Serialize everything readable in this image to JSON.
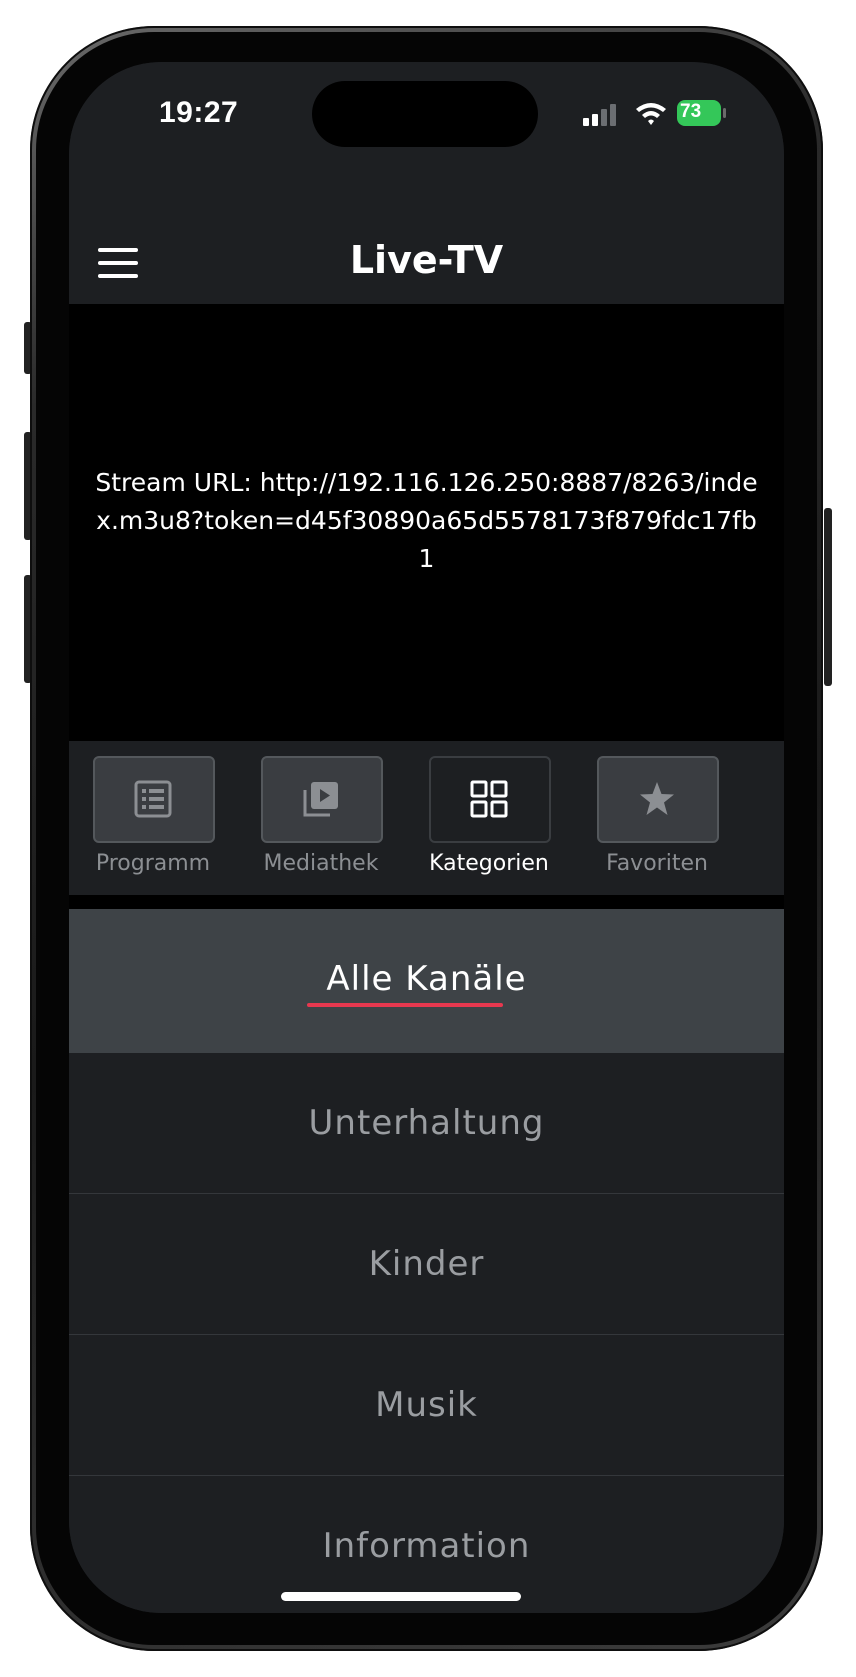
{
  "status_bar": {
    "time": "19:27",
    "battery": "73",
    "icons": [
      "signal-icon",
      "wifi-icon",
      "battery-icon"
    ]
  },
  "header": {
    "title": "Live-TV",
    "menu_icon": "hamburger-menu-icon"
  },
  "stream": {
    "text": "Stream URL: http://192.116.126.250:8887/8263/index.m3u8?token=d45f30890a65d5578173f879fdc17fb1"
  },
  "tabs": [
    {
      "label": "Programm",
      "icon": "list-icon",
      "active": false
    },
    {
      "label": "Mediathek",
      "icon": "media-library-icon",
      "active": false
    },
    {
      "label": "Kategorien",
      "icon": "grid-icon",
      "active": true
    },
    {
      "label": "Favoriten",
      "icon": "star-icon",
      "active": false
    }
  ],
  "categories": [
    {
      "label": "Alle Kanäle",
      "selected": true
    },
    {
      "label": "Unterhaltung",
      "selected": false
    },
    {
      "label": "Kinder",
      "selected": false
    },
    {
      "label": "Musik",
      "selected": false
    },
    {
      "label": "Information",
      "selected": false
    }
  ],
  "colors": {
    "background": "#1d1f22",
    "selected_row": "#3e4347",
    "accent_underline": "#e8384f",
    "battery_green": "#34c759"
  }
}
